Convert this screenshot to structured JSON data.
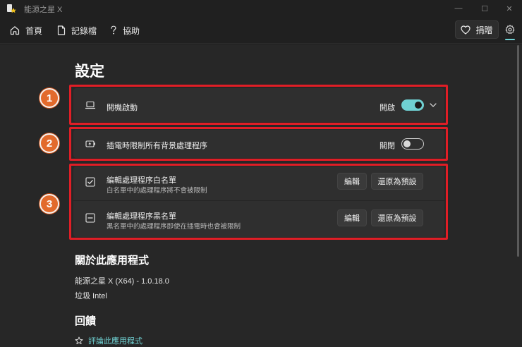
{
  "window": {
    "title": "能源之星 X",
    "minimize": "—",
    "maximize": "☐",
    "close": "✕"
  },
  "nav": {
    "home": "首頁",
    "log": "記錄檔",
    "help": "協助",
    "donate": "捐贈"
  },
  "page": {
    "title": "設定"
  },
  "settings": {
    "startup": {
      "label": "開機啟動",
      "state": "開啟",
      "enabled": true
    },
    "throttle": {
      "label": "插電時限制所有背景處理程序",
      "state": "關閉",
      "enabled": false
    },
    "whitelist": {
      "label": "編輯處理程序白名單",
      "description": "白名單中的處理程序將不會被限制",
      "edit_label": "編輯",
      "reset_label": "還原為預設"
    },
    "blacklist": {
      "label": "編輯處理程序黑名單",
      "description": "黑名單中的處理程序即使在插電時也會被限制",
      "edit_label": "編輯",
      "reset_label": "還原為預設"
    }
  },
  "markers": [
    "1",
    "2",
    "3"
  ],
  "about": {
    "title": "關於此應用程式",
    "version": "能源之星 X (X64) - 1.0.18.0",
    "author": "垃圾 Intel"
  },
  "feedback": {
    "title": "回饋",
    "rate_label": "評論此應用程式"
  },
  "colors": {
    "accent": "#6fd0d2",
    "annotation_box": "#e01e26",
    "annotation_marker": "#e26a2c",
    "background": "#272727",
    "card": "#2f2f2f"
  }
}
